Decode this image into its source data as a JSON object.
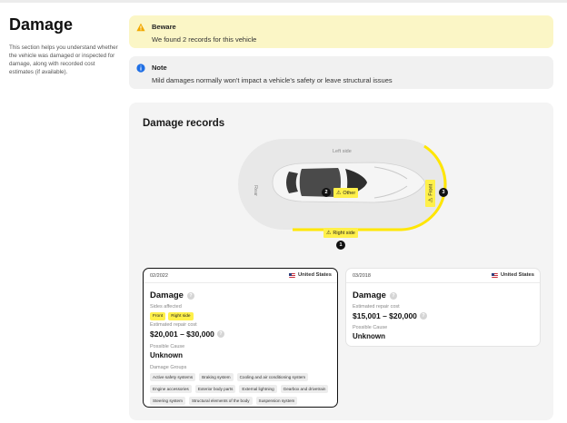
{
  "page": {
    "title": "Damage",
    "description": "This section helps you understand whether the vehicle was damaged or inspected for damage, along with recorded cost estimates (if available)."
  },
  "alerts": {
    "beware": {
      "icon": "warning-icon",
      "title": "Beware",
      "text": "We found 2 records for this vehicle",
      "color": "#fbf6c6"
    },
    "note": {
      "icon": "info-icon",
      "title": "Note",
      "text": "Mild damages normally won't impact a vehicle's safety or leave structural issues",
      "color": "#f1f1f1"
    }
  },
  "records": {
    "title": "Damage records",
    "diagram": {
      "left_side_label": "Left side",
      "rear_label": "Rear",
      "highlight_color": "#ffe600",
      "markers": [
        {
          "number": "1",
          "label": "Right side"
        },
        {
          "number": "2",
          "label": "Other"
        },
        {
          "number": "3",
          "label": "Front"
        }
      ]
    },
    "cards": [
      {
        "date": "02/2022",
        "country": "United States",
        "title": "Damage",
        "sides_label": "Sides affected",
        "sides": [
          "Front",
          "Right side"
        ],
        "cost_label": "Estimated repair cost",
        "cost": "$20,001 – $30,000",
        "cause_label": "Possible Cause",
        "cause": "Unknown",
        "groups_label": "Damage Groups",
        "groups": [
          "Active safety systems",
          "Braking system",
          "Cooling and air conditioning system",
          "Engine accessories",
          "Exterior body parts",
          "External lightning",
          "Gearbox and drivetrain",
          "Steering system",
          "Structural elements of the body",
          "Suspension system"
        ],
        "selected": true
      },
      {
        "date": "03/2018",
        "country": "United States",
        "title": "Damage",
        "cost_label": "Estimated repair cost",
        "cost": "$15,001 – $20,000",
        "cause_label": "Possible Cause",
        "cause": "Unknown",
        "selected": false
      }
    ]
  }
}
